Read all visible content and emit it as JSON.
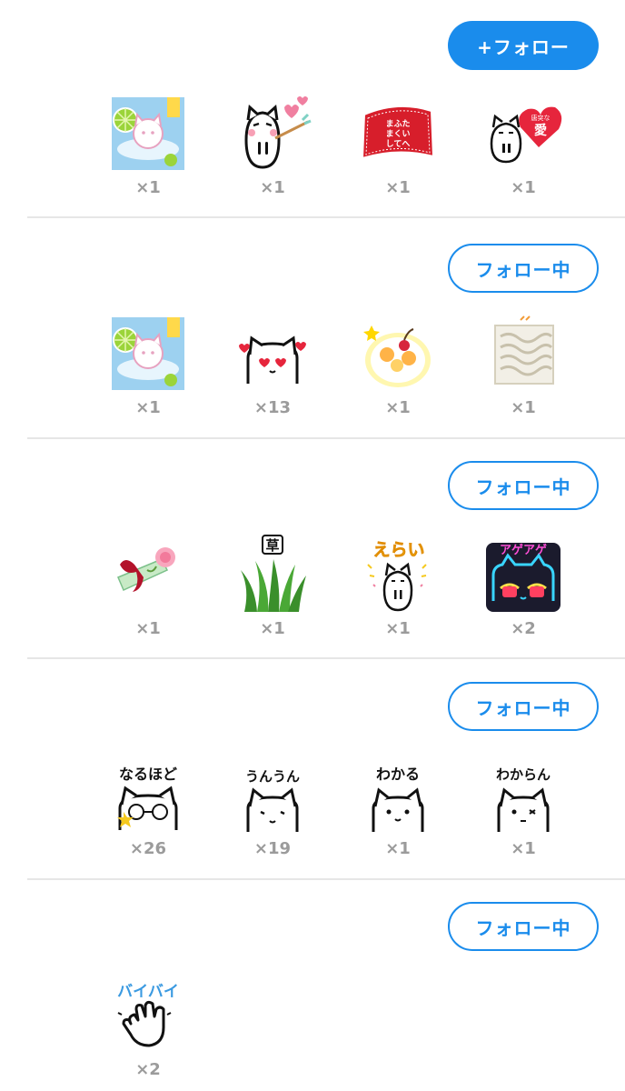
{
  "sections": [
    {
      "button": "+フォロー",
      "stickers": [
        {
          "name": "cat-splash-sticker-icon",
          "count": "×1"
        },
        {
          "name": "cat-cupid-sticker-icon",
          "count": "×1"
        },
        {
          "name": "red-message-card-sticker-icon",
          "count": "×1",
          "text": "まふたいまくいしてへたきぃん"
        },
        {
          "name": "cat-heart-love-sticker-icon",
          "count": "×1",
          "text": "唐突な愛"
        }
      ]
    },
    {
      "button": "フォロー中",
      "stickers": [
        {
          "name": "cat-splash-sticker-icon",
          "count": "×1"
        },
        {
          "name": "cat-heart-eyes-sticker-icon",
          "count": "×13"
        },
        {
          "name": "fruit-parfait-sticker-icon",
          "count": "×1"
        },
        {
          "name": "noodles-sticker-icon",
          "count": "×1"
        }
      ]
    },
    {
      "button": "フォロー中",
      "stickers": [
        {
          "name": "rose-bouquet-sticker-icon",
          "count": "×1"
        },
        {
          "name": "grass-sticker-icon",
          "count": "×1",
          "text": "草"
        },
        {
          "name": "cat-erai-sticker-icon",
          "count": "×1",
          "text": "えらい"
        },
        {
          "name": "neon-cat-agearge-sticker-icon",
          "count": "×2",
          "text": "アゲアゲ"
        }
      ]
    },
    {
      "button": "フォロー中",
      "stickers": [
        {
          "name": "cat-narunahodo-sticker-icon",
          "count": "×26",
          "text": "なるほど"
        },
        {
          "name": "cat-unun-sticker-icon",
          "count": "×19",
          "text": "うんうん"
        },
        {
          "name": "cat-wakaru-sticker-icon",
          "count": "×1",
          "text": "わかる"
        },
        {
          "name": "cat-wakaran-sticker-icon",
          "count": "×1",
          "text": "わからん"
        }
      ]
    },
    {
      "button": "フォロー中",
      "stickers": [
        {
          "name": "hand-wave-byebye-sticker-icon",
          "count": "×2",
          "text": "バイバイ"
        }
      ]
    }
  ],
  "colors": {
    "accent": "#1a8cec",
    "count": "#9b9b9b",
    "divider": "#e6e6e6"
  }
}
